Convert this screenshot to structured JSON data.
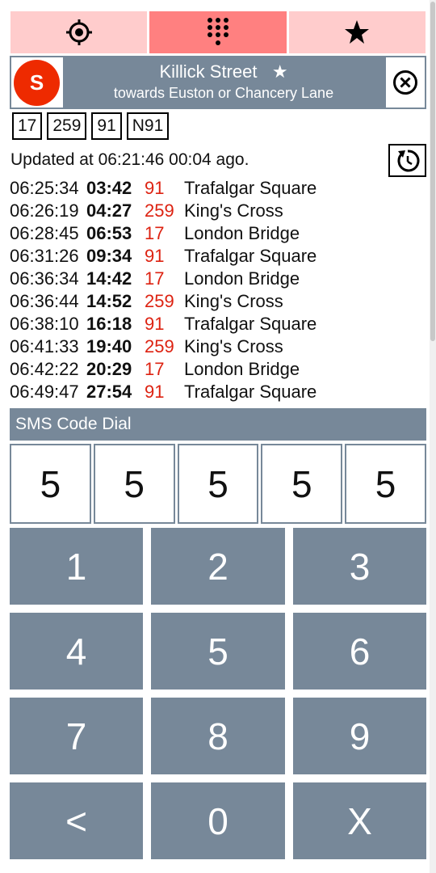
{
  "tabs": [
    {
      "icon": "crosshair-location-icon",
      "state": "inactive"
    },
    {
      "icon": "dialpad-icon",
      "state": "active"
    },
    {
      "icon": "star-icon",
      "state": "inactive"
    }
  ],
  "stop": {
    "badge_letter": "S",
    "name": "Killick Street",
    "favourite_mark": "★",
    "direction": "towards Euston or Chancery Lane"
  },
  "routes": [
    "17",
    "259",
    "91",
    "N91"
  ],
  "status": {
    "updated_text": "Updated at 06:21:46 00:04 ago."
  },
  "arrivals": [
    {
      "time": "06:25:34",
      "due": "03:42",
      "route": "91",
      "destination": "Trafalgar Square"
    },
    {
      "time": "06:26:19",
      "due": "04:27",
      "route": "259",
      "destination": "King's Cross"
    },
    {
      "time": "06:28:45",
      "due": "06:53",
      "route": "17",
      "destination": "London Bridge"
    },
    {
      "time": "06:31:26",
      "due": "09:34",
      "route": "91",
      "destination": "Trafalgar Square"
    },
    {
      "time": "06:36:34",
      "due": "14:42",
      "route": "17",
      "destination": "London Bridge"
    },
    {
      "time": "06:36:44",
      "due": "14:52",
      "route": "259",
      "destination": "King's Cross"
    },
    {
      "time": "06:38:10",
      "due": "16:18",
      "route": "91",
      "destination": "Trafalgar Square"
    },
    {
      "time": "06:41:33",
      "due": "19:40",
      "route": "259",
      "destination": "King's Cross"
    },
    {
      "time": "06:42:22",
      "due": "20:29",
      "route": "17",
      "destination": "London Bridge"
    },
    {
      "time": "06:49:47",
      "due": "27:54",
      "route": "91",
      "destination": "Trafalgar Square"
    }
  ],
  "sms": {
    "title": "SMS Code Dial",
    "code_digits": [
      "5",
      "5",
      "5",
      "5",
      "5"
    ]
  },
  "keypad": [
    "1",
    "2",
    "3",
    "4",
    "5",
    "6",
    "7",
    "8",
    "9",
    "<",
    "0",
    "X"
  ],
  "colors": {
    "tab_light": "#ffcccc",
    "tab_active": "#ff8080",
    "panel": "#778899",
    "stop_badge": "#ee2a00",
    "route_text": "#dd2211"
  }
}
